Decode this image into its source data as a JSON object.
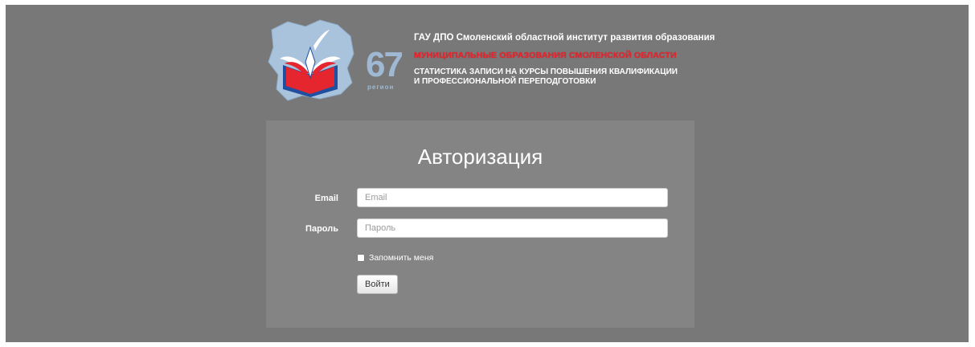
{
  "header": {
    "org_title": "ГАУ ДПО Смоленский областной институт развития образования",
    "org_subtitle": "МУНИЦИПАЛЬНЫЕ ОБРАЗОВАНИЯ СМОЛЕНСКОЙ ОБЛАСТИ",
    "desc_line1": "СТАТИСТИКА ЗАПИСИ НА КУРСЫ ПОВЫШЕНИЯ КВАЛИФИКАЦИИ",
    "desc_line2": "И ПРОФЕССИОНАЛЬНОЙ ПЕРЕПОДГОТОВКИ",
    "region_number": "67",
    "region_word": "регион",
    "logo_icon": "region-map-book-logo"
  },
  "login": {
    "title": "Авторизация",
    "email_label": "Email",
    "email_placeholder": "Email",
    "email_value": "",
    "password_label": "Пароль",
    "password_placeholder": "Пароль",
    "password_value": "",
    "remember_label": "Запомнить меня",
    "remember_checked": false,
    "submit_label": "Войти"
  },
  "colors": {
    "page_bg": "#787878",
    "panel_bg": "#848484",
    "accent_red": "#e0272f",
    "accent_blue": "#9fb9d4"
  }
}
